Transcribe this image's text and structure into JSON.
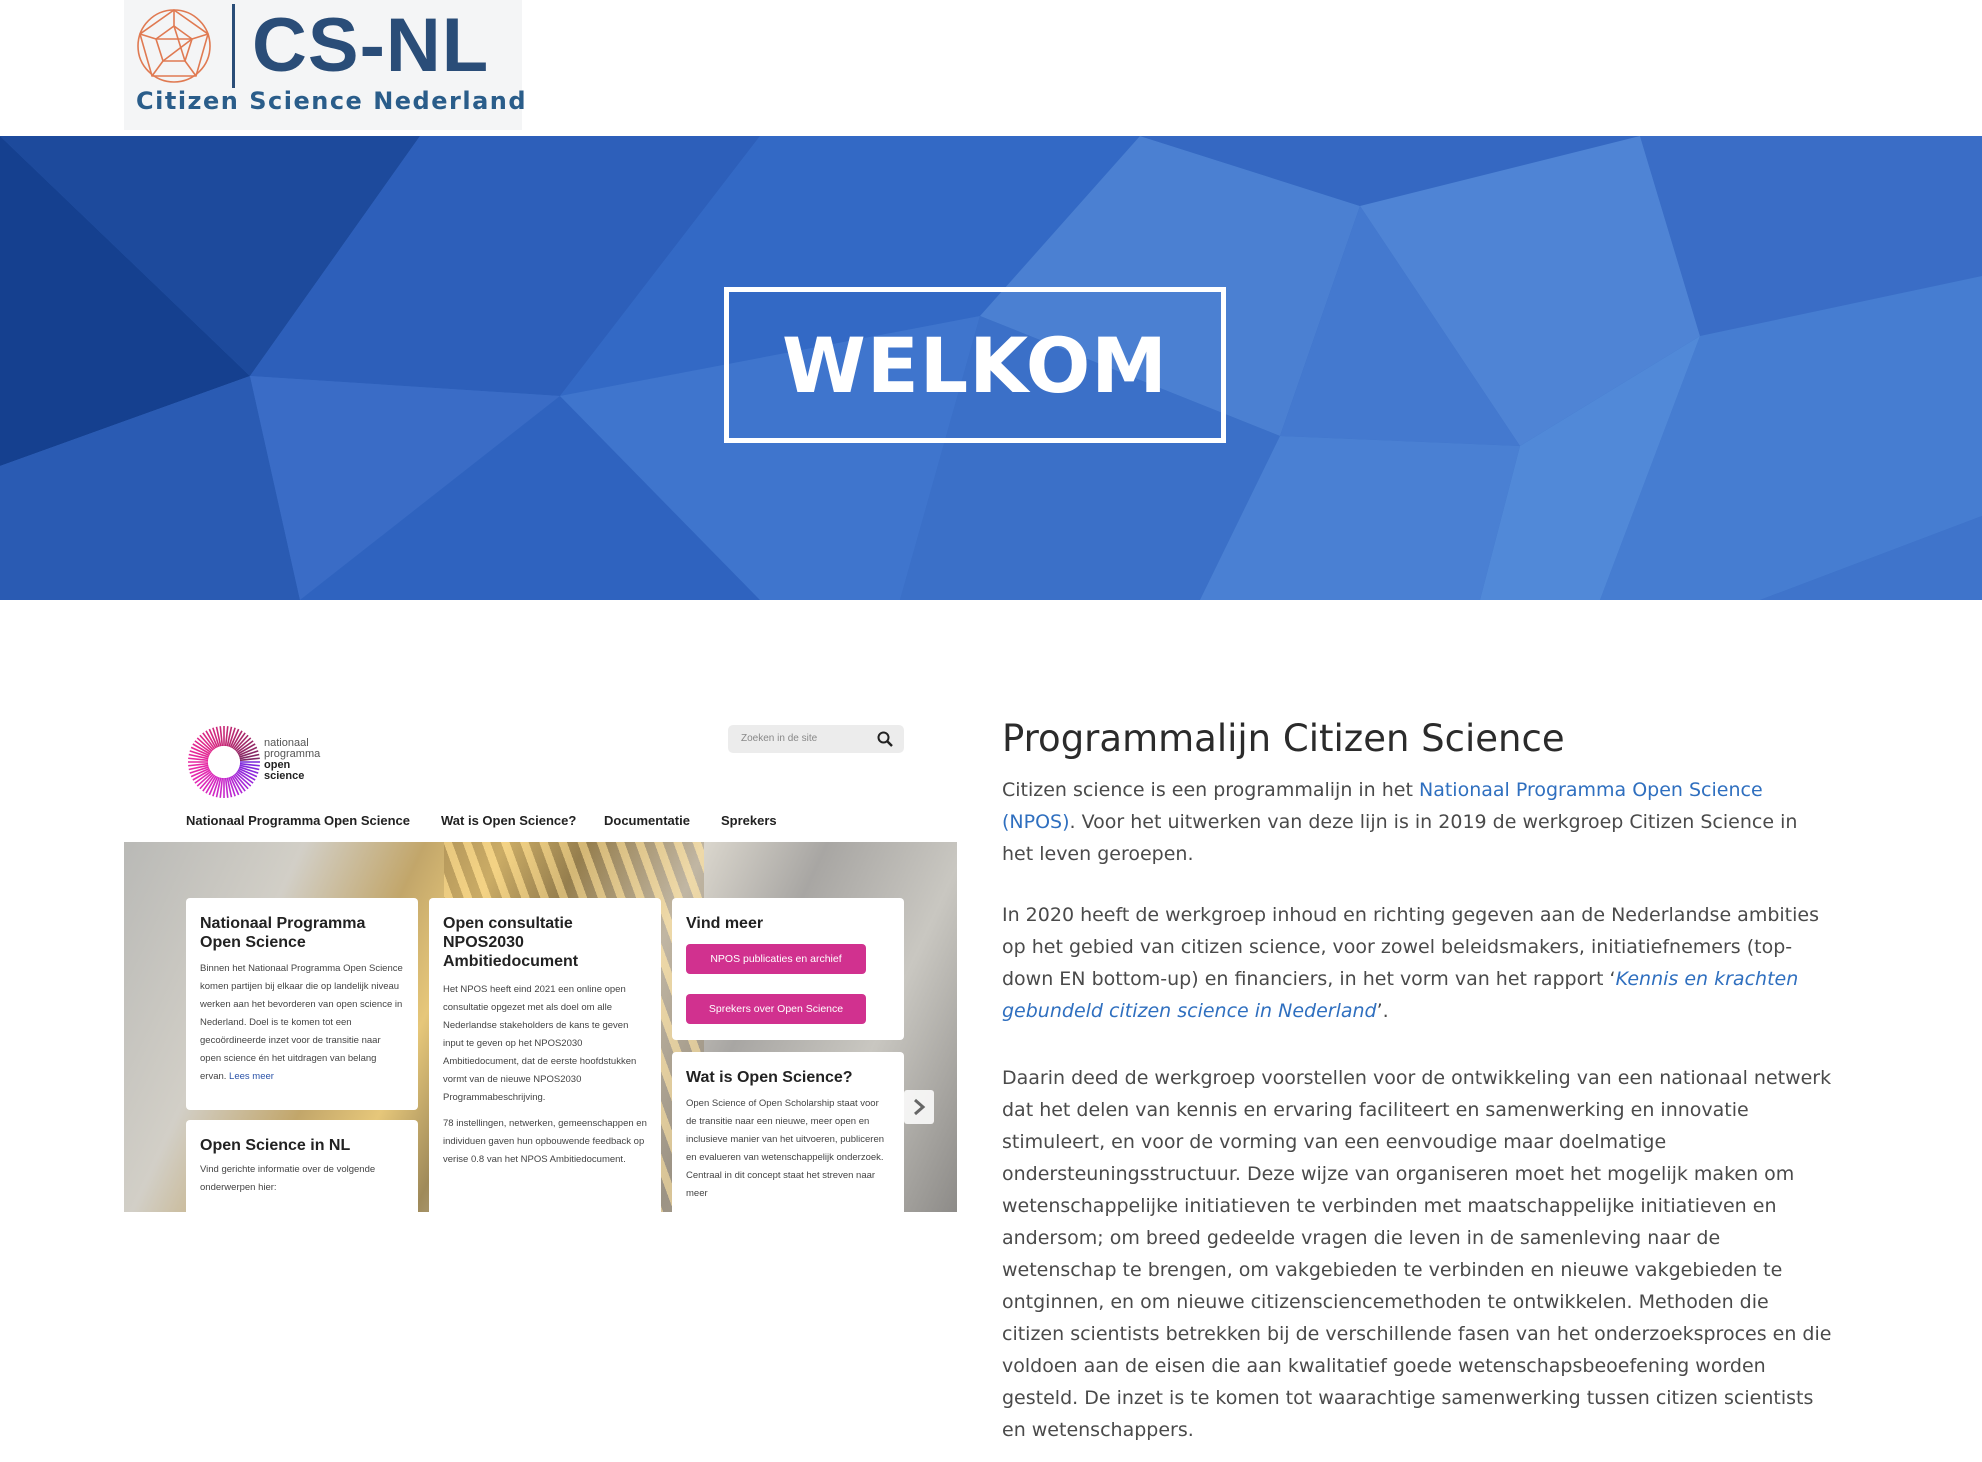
{
  "header": {
    "logo_title": "CS-NL",
    "logo_subtitle": "Citizen Science Nederland"
  },
  "hero": {
    "heading": "WELKOM"
  },
  "screenshot": {
    "logo_line1": "nationaal",
    "logo_line2": "programma",
    "logo_line3": "open",
    "logo_line4": "science",
    "search_placeholder": "Zoeken in de site",
    "nav": [
      "Nationaal Programma Open Science",
      "Wat is Open Science?",
      "Documentatie",
      "Sprekers"
    ],
    "card1": {
      "title": "Nationaal Programma Open Science",
      "text": "Binnen het Nationaal Programma Open Science komen partijen bij elkaar die op landelijk niveau werken aan het bevorderen van open science in Nederland. Doel is te komen tot een gecoördineerde inzet voor de transitie naar open science én het uitdragen van belang ervan.",
      "more": "Lees meer"
    },
    "card2": {
      "title": "Open Science in NL",
      "text": "Vind gerichte informatie over de volgende onderwerpen hier:"
    },
    "card3": {
      "title": "Open consultatie NPOS2030 Ambitiedocument",
      "text1": "Het NPOS heeft eind 2021 een online open consultatie opgezet met als doel om alle Nederlandse stakeholders de kans te geven input te geven op het NPOS2030 Ambitiedocument, dat de eerste hoofdstukken vormt van de nieuwe NPOS2030 Programmabeschrijving.",
      "text2": "78 instellingen, netwerken, gemeenschappen en individuen gaven hun opbouwende feedback op verise 0.8 van het NPOS Ambitiedocument."
    },
    "card4": {
      "title": "Vind meer",
      "button1": "NPOS publicaties en archief",
      "button2": "Sprekers over Open Science"
    },
    "card5": {
      "title": "Wat is Open Science?",
      "text": "Open Science of Open Scholarship staat voor de transitie naar een nieuwe, meer open en inclusieve manier van het uitvoeren, publiceren en evalueren van wetenschappelijk onderzoek. Centraal in dit concept staat het streven naar meer"
    }
  },
  "article": {
    "title": "Programmalijn Citizen Science",
    "p1_before": "Citizen science is een programmalijn in het ",
    "p1_link": "Nationaal Programma Open Science (NPOS)",
    "p1_after": ". Voor het uitwerken van deze lijn is in 2019 de werkgroep Citizen Science in het leven geroepen.",
    "p2_before": "In 2020 heeft de werkgroep inhoud en richting gegeven aan de Nederlandse ambities op het gebied van citizen science, voor zowel beleidsmakers, initiatiefnemers (top-down EN bottom-up) en financiers, in het vorm van het rapport ‘",
    "p2_link": "Kennis en krachten gebundeld citizen science in Nederland",
    "p2_after": "’.",
    "p3": "Daarin deed de werkgroep voorstellen voor de ontwikkeling van een nationaal netwerk dat het delen van kennis en ervaring faciliteert en samenwerking en innovatie stimuleert, en voor de vorming van een eenvoudige maar doelmatige ondersteuningsstructuur. Deze wijze van organiseren moet het mogelijk maken om wetenschappelijke initiatieven te verbinden met maatschappelijke initiatieven en andersom; om breed gedeelde vragen die leven in de samenleving naar de wetenschap te brengen, om vakgebieden te verbinden en nieuwe vakgebieden te ontginnen, en om nieuwe citizensciencemethoden te ontwikkelen. Methoden die citizen scientists betrekken bij de verschillende fasen van het onderzoeksproces en die voldoen aan de eisen die aan kwalitatief goede wetenschapsbeoefening worden gesteld. De inzet is te komen tot waarachtige samenwerking tussen citizen scientists en wetenschappers."
  },
  "colors": {
    "brand_navy": "#2a4d78",
    "hero_blue": "#3a6fc4",
    "link_blue": "#2f6fbf",
    "pill_pink": "#d1318f"
  }
}
